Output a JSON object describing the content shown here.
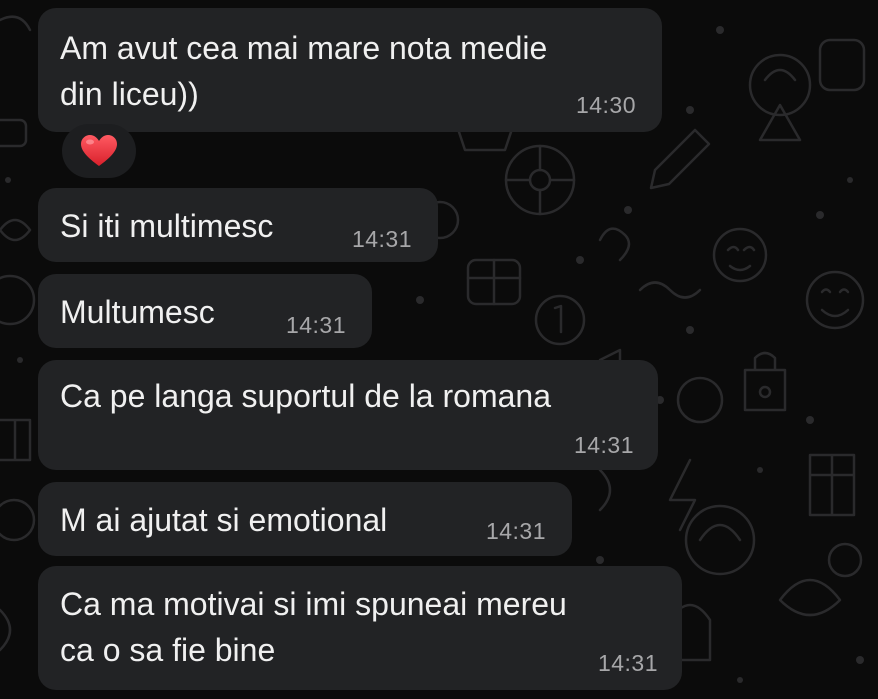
{
  "messages": [
    {
      "lines": [
        "Am avut cea mai mare nota medie",
        "din liceu))"
      ],
      "time": "14:30"
    },
    {
      "lines": [
        "Si iti multimesc"
      ],
      "time": "14:31"
    },
    {
      "lines": [
        "Multumesc"
      ],
      "time": "14:31"
    },
    {
      "lines": [
        "Ca pe langa suportul de la romana"
      ],
      "time": "14:31"
    },
    {
      "lines": [
        "M ai ajutat si emotional"
      ],
      "time": "14:31"
    },
    {
      "lines": [
        "Ca ma motivai si imi spuneai mereu",
        "ca o sa fie bine"
      ],
      "time": "14:31"
    }
  ],
  "reaction": {
    "emoji": "heart",
    "color": "#e8323c"
  },
  "colors": {
    "background": "#0b0b0b",
    "bubble": "#222325",
    "text": "#f0f0f0",
    "timestamp": "#a7a7a9"
  }
}
